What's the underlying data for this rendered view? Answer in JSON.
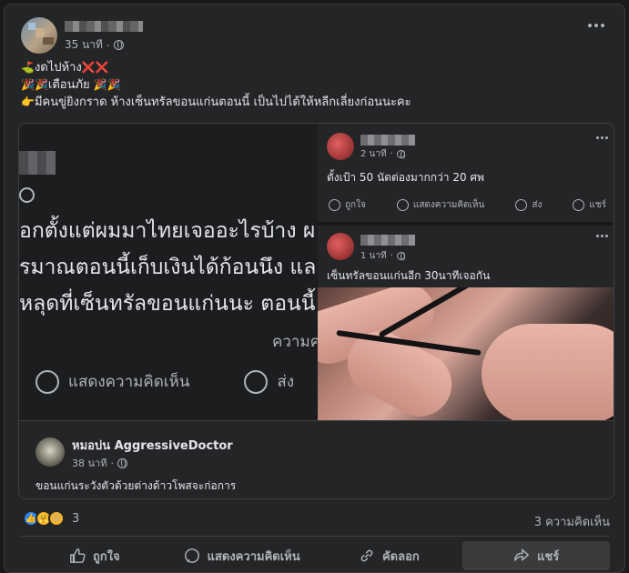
{
  "post": {
    "time": "35 นาที",
    "lines": [
      {
        "emoji": "⛳",
        "text": "งดไปห้าง",
        "trail": "❌❌"
      },
      {
        "emoji": "🎉🎉",
        "text": "เตือนภัย ",
        "trail": "🎉🎉"
      },
      {
        "emoji": "👉",
        "text": "มีคนขู่ยิงกราด ห้างเซ็นทรัลขอนแก่นตอนนี้ เป็นไปได้ให้หลีกเลี่ยงก่อนนะคะ",
        "trail": ""
      }
    ]
  },
  "shared": {
    "big_lines": [
      "อกตั้งแต่ผมมาไทยเจออะไรบ้าง ผ",
      "รมาณตอนนี้เก็บเงินได้ก้อนนึง แล",
      "หลุดที่เซ็นทรัลขอนแก่นนะ ตอนนี้"
    ],
    "big_dim": "ความค",
    "big_comment": "แสดงความคิดเห็น",
    "big_share": "ส่ง",
    "mini1": {
      "time": "2 นาที",
      "text": "ตั้งเป้า 50 นัดต่องมากกว่า 20 ศพ",
      "like": "ถูกใจ",
      "comment": "แสดงความคิดเห็น",
      "send": "ส่ง",
      "share": "แชร์"
    },
    "mini2": {
      "time": "1 นาที",
      "text": "เซ็นทรัลขอนแก่นอีก 30นาทีเจอกัน"
    },
    "comment": {
      "name": "หมอบ่น AggressiveDoctor",
      "time": "38 นาที",
      "text": "ขอนแก่นระวังตัวด้วยต่างด้าวโพสจะก่อการ"
    }
  },
  "stats": {
    "reactions": "3",
    "comments": "3 ความคิดเห็น"
  },
  "actions": {
    "like": "ถูกใจ",
    "comment": "แสดงความคิดเห็น",
    "copy": "คัดลอก",
    "share": "แชร์"
  }
}
